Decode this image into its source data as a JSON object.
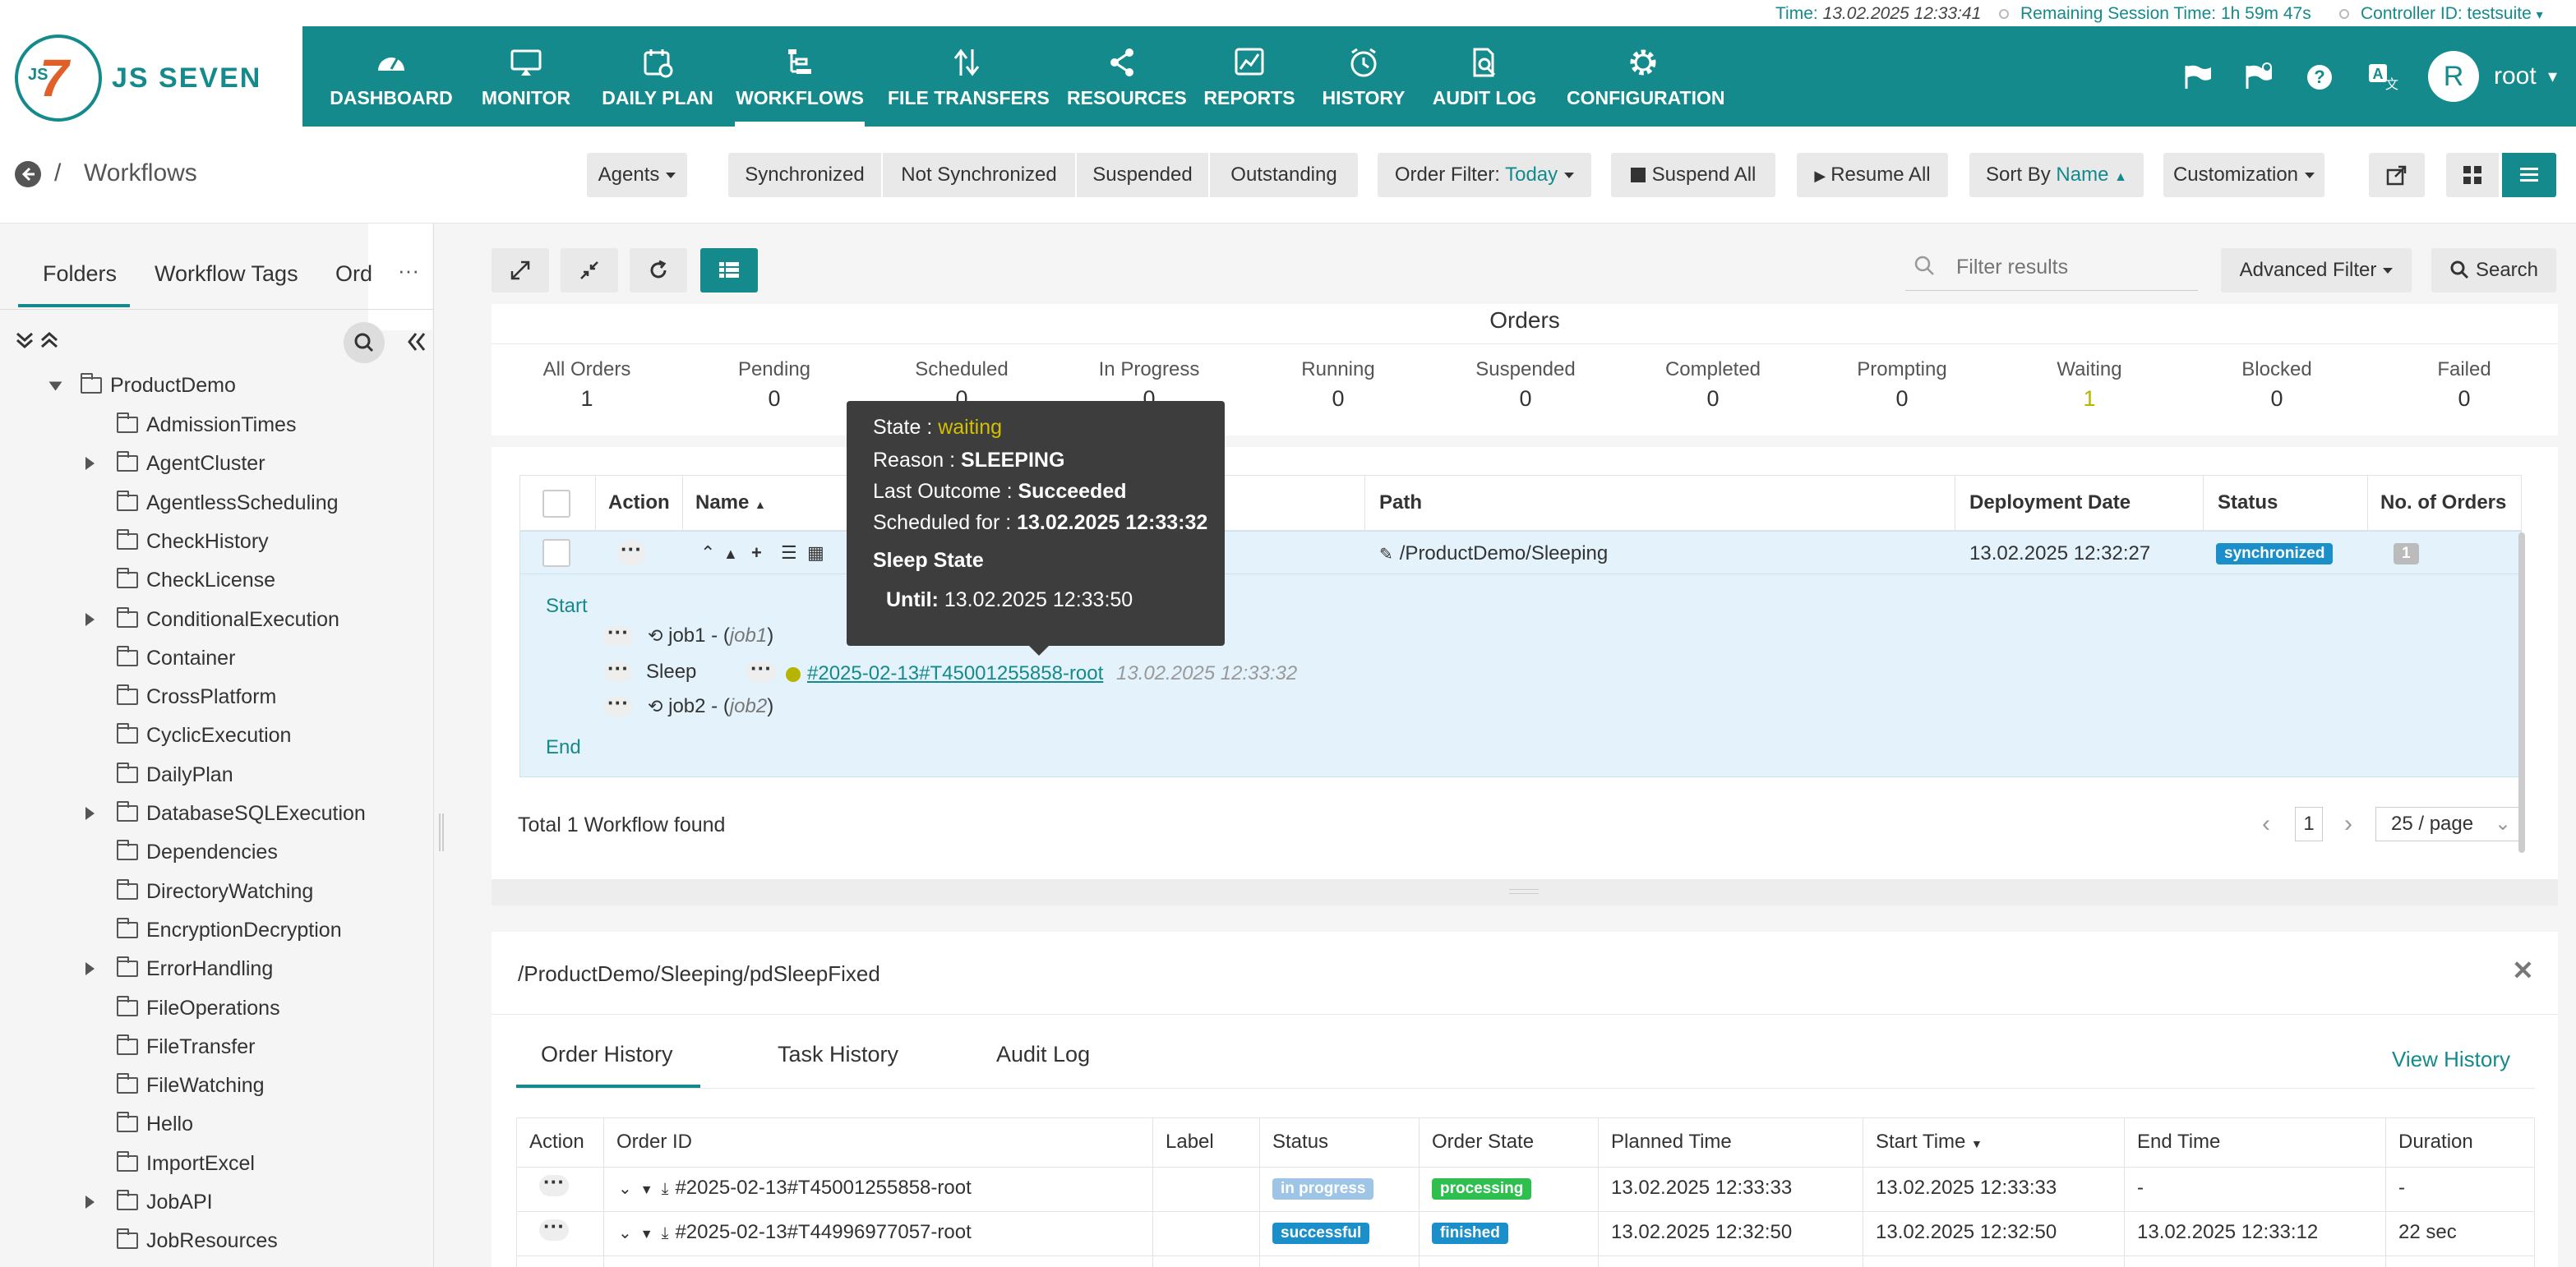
{
  "topbar": {
    "time_label": "Time:",
    "time_value": "13.02.2025 12:33:41",
    "session_label": "Remaining Session Time:",
    "session_value": "1h 59m 47s",
    "controller_label": "Controller ID:",
    "controller_value": "testsuite"
  },
  "app": {
    "name": "JS SEVEN",
    "logo_mark": "JS7"
  },
  "nav": [
    {
      "label": "DASHBOARD",
      "icon": "dashboard-icon"
    },
    {
      "label": "MONITOR",
      "icon": "monitor-icon"
    },
    {
      "label": "DAILY PLAN",
      "icon": "calendar-icon"
    },
    {
      "label": "WORKFLOWS",
      "icon": "workflow-icon"
    },
    {
      "label": "FILE TRANSFERS",
      "icon": "file-transfer-icon"
    },
    {
      "label": "RESOURCES",
      "icon": "share-icon"
    },
    {
      "label": "REPORTS",
      "icon": "chart-icon"
    },
    {
      "label": "HISTORY",
      "icon": "clock-icon"
    },
    {
      "label": "AUDIT LOG",
      "icon": "audit-icon"
    },
    {
      "label": "CONFIGURATION",
      "icon": "gear-icon"
    }
  ],
  "user": {
    "avatar": "R",
    "name": "root"
  },
  "breadcrumb": {
    "title": "Workflows"
  },
  "toolbar": {
    "agents": "Agents",
    "synchronized": "Synchronized",
    "not_synchronized": "Not Synchronized",
    "suspended": "Suspended",
    "outstanding": "Outstanding",
    "order_filter_label": "Order Filter:",
    "order_filter_value": "Today",
    "suspend_all": "Suspend All",
    "resume_all": "Resume All",
    "sort_by_label": "Sort By",
    "sort_by_value": "Name",
    "customization": "Customization"
  },
  "left_tabs": [
    "Folders",
    "Workflow Tags",
    "Ord"
  ],
  "left_more": "···",
  "tree": {
    "root": "ProductDemo",
    "items": [
      {
        "label": "AdmissionTimes",
        "expandable": false
      },
      {
        "label": "AgentCluster",
        "expandable": true
      },
      {
        "label": "AgentlessScheduling",
        "expandable": false
      },
      {
        "label": "CheckHistory",
        "expandable": false
      },
      {
        "label": "CheckLicense",
        "expandable": false
      },
      {
        "label": "ConditionalExecution",
        "expandable": true
      },
      {
        "label": "Container",
        "expandable": false
      },
      {
        "label": "CrossPlatform",
        "expandable": false
      },
      {
        "label": "CyclicExecution",
        "expandable": false
      },
      {
        "label": "DailyPlan",
        "expandable": false
      },
      {
        "label": "DatabaseSQLExecution",
        "expandable": true
      },
      {
        "label": "Dependencies",
        "expandable": false
      },
      {
        "label": "DirectoryWatching",
        "expandable": false
      },
      {
        "label": "EncryptionDecryption",
        "expandable": false
      },
      {
        "label": "ErrorHandling",
        "expandable": true
      },
      {
        "label": "FileOperations",
        "expandable": false
      },
      {
        "label": "FileTransfer",
        "expandable": false
      },
      {
        "label": "FileWatching",
        "expandable": false
      },
      {
        "label": "Hello",
        "expandable": false
      },
      {
        "label": "ImportExcel",
        "expandable": false
      },
      {
        "label": "JobAPI",
        "expandable": true
      },
      {
        "label": "JobResources",
        "expandable": false
      }
    ]
  },
  "filter": {
    "placeholder": "Filter results",
    "advanced": "Advanced Filter",
    "search": "Search"
  },
  "orders": {
    "title": "Orders",
    "stats": [
      {
        "label": "All Orders",
        "value": "1"
      },
      {
        "label": "Pending",
        "value": "0"
      },
      {
        "label": "Scheduled",
        "value": "0"
      },
      {
        "label": "In Progress",
        "value": "0"
      },
      {
        "label": "Running",
        "value": "0"
      },
      {
        "label": "Suspended",
        "value": "0"
      },
      {
        "label": "Completed",
        "value": "0"
      },
      {
        "label": "Prompting",
        "value": "0"
      },
      {
        "label": "Waiting",
        "value": "1"
      },
      {
        "label": "Blocked",
        "value": "0"
      },
      {
        "label": "Failed",
        "value": "0"
      }
    ]
  },
  "workflow_table": {
    "headers": {
      "action": "Action",
      "name": "Name",
      "path": "Path",
      "deployment": "Deployment Date",
      "status": "Status",
      "orders": "No. of Orders"
    },
    "row": {
      "name": "pdSleepFixed",
      "path": "/ProductDemo/Sleeping",
      "deployment": "13.02.2025 12:32:27",
      "status": "synchronized",
      "orders": "1"
    },
    "detail": {
      "start": "Start",
      "job1": "job1 -",
      "job1_ref": "job1",
      "sleep": "Sleep",
      "order_id": "#2025-02-13#T45001255858-root",
      "order_time": "13.02.2025 12:33:32",
      "job2": "job2 -",
      "job2_ref": "job2",
      "end": "End"
    },
    "total": "Total 1 Workflow found",
    "page": "1",
    "per_page": "25 / page"
  },
  "tooltip": {
    "state_label": "State :",
    "state_value": "waiting",
    "reason_label": "Reason :",
    "reason_value": "SLEEPING",
    "outcome_label": "Last Outcome :",
    "outcome_value": "Succeeded",
    "scheduled_label": "Scheduled for :",
    "scheduled_value": "13.02.2025 12:33:32",
    "sleep_title": "Sleep State",
    "until_label": "Until:",
    "until_value": "13.02.2025 12:33:50"
  },
  "bottom": {
    "path": "/ProductDemo/Sleeping/pdSleepFixed",
    "tabs": [
      "Order History",
      "Task History",
      "Audit Log"
    ],
    "view_history": "View History",
    "headers": [
      "Action",
      "Order ID",
      "Label",
      "Status",
      "Order State",
      "Planned Time",
      "Start Time",
      "End Time",
      "Duration"
    ],
    "rows": [
      {
        "order_id": "#2025-02-13#T45001255858-root",
        "label": "",
        "status": "in progress",
        "state": "processing",
        "planned": "13.02.2025 12:33:33",
        "start": "13.02.2025 12:33:33",
        "end": "-",
        "duration": "-"
      },
      {
        "order_id": "#2025-02-13#T44996977057-root",
        "label": "",
        "status": "successful",
        "state": "finished",
        "planned": "13.02.2025 12:32:50",
        "start": "13.02.2025 12:32:50",
        "end": "13.02.2025 12:33:12",
        "duration": "22 sec"
      }
    ]
  },
  "colors": {
    "accent": "#148a8c",
    "waiting": "#b5b500",
    "synchronized": "#1a8fc9",
    "in_progress": "#9ec5e6",
    "processing": "#2fbf4f",
    "successful": "#1a8fc9",
    "finished": "#1a8fc9",
    "tooltip_bg": "#3d3d3d"
  }
}
